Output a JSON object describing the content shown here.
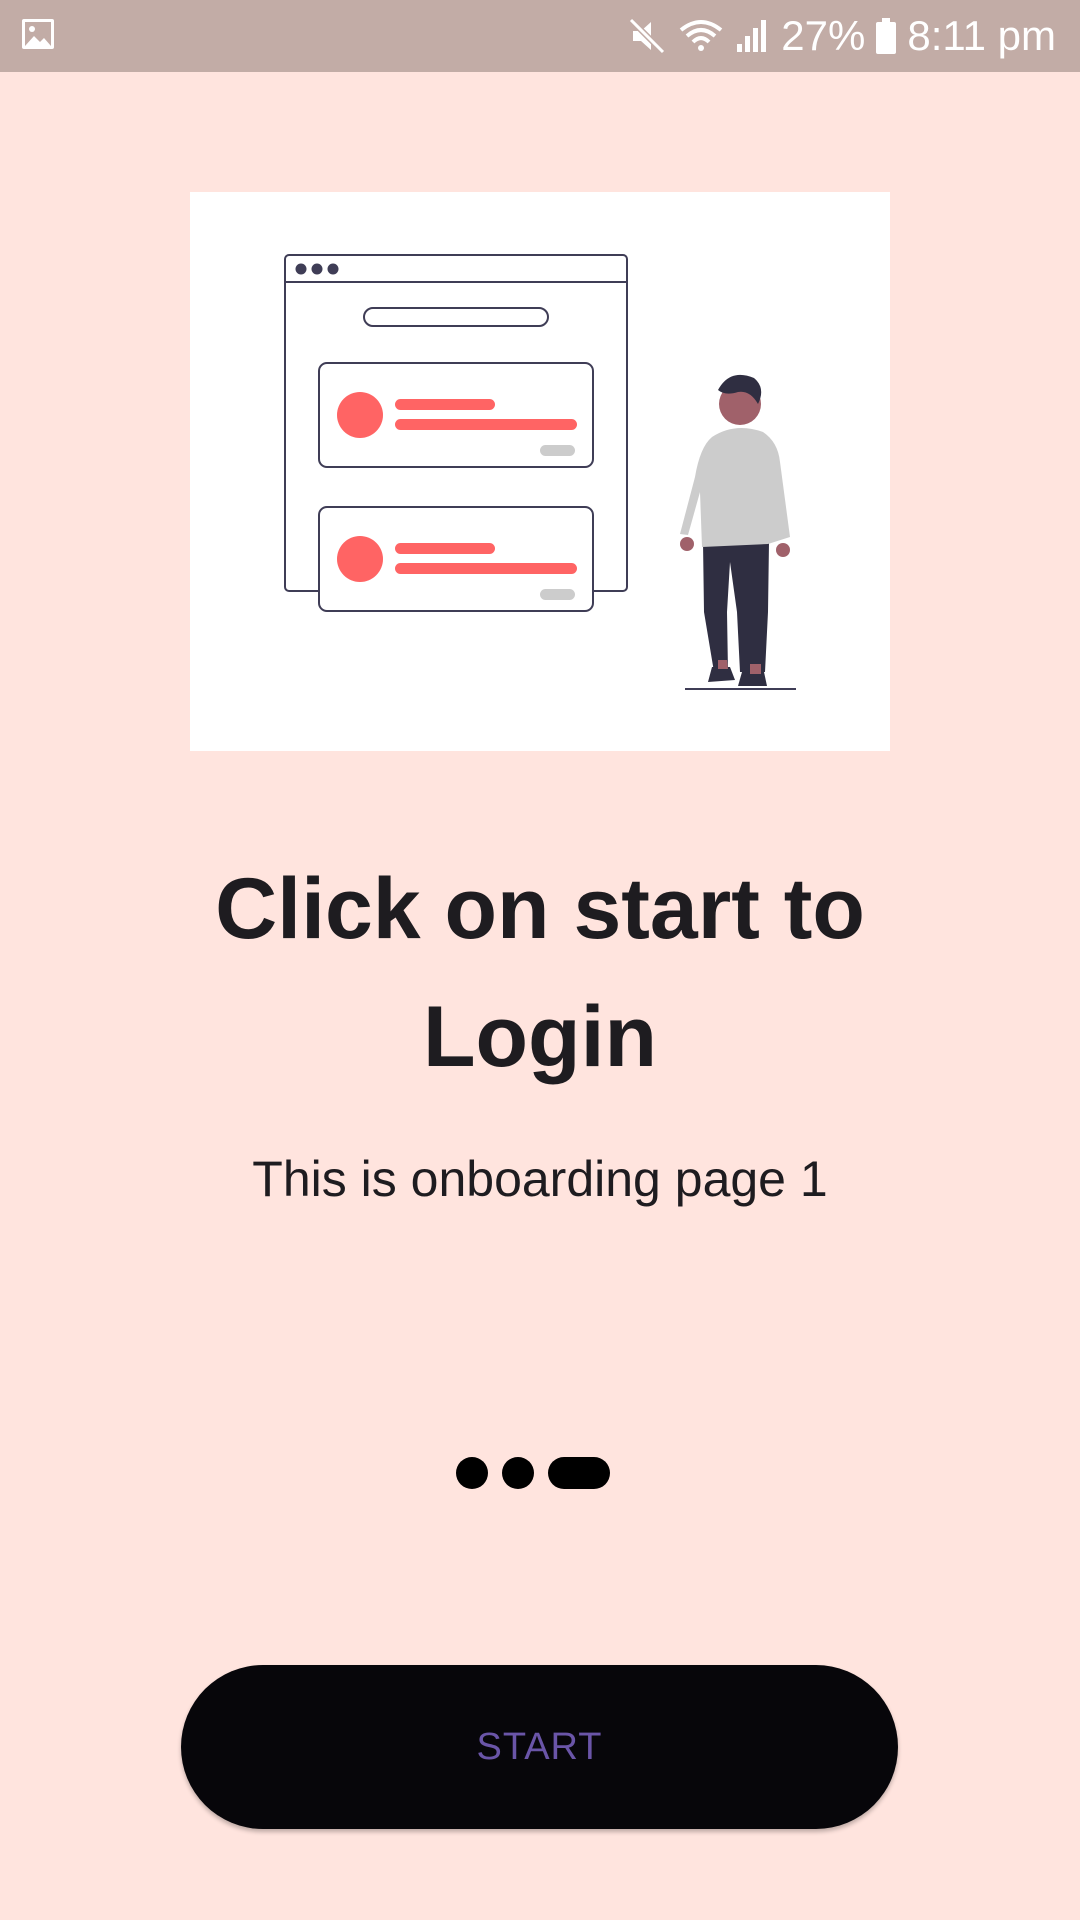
{
  "status_bar": {
    "battery": "27%",
    "time": "8:11 pm",
    "icons": [
      "gallery-icon",
      "mute-icon",
      "wifi-icon",
      "signal-icon",
      "battery-icon"
    ]
  },
  "illustration": {
    "icon": "onboarding-illustration",
    "accent_color": "#ff6464"
  },
  "onboarding": {
    "title": "Click on start to Login",
    "subtitle": "This is onboarding page 1",
    "page_count": 3,
    "active_page": 3
  },
  "start_button": {
    "label": "START"
  },
  "colors": {
    "background": "#ffe4de",
    "status_bar": "#c2aca6",
    "button": "#07060a",
    "button_text": "#6a55a8"
  }
}
